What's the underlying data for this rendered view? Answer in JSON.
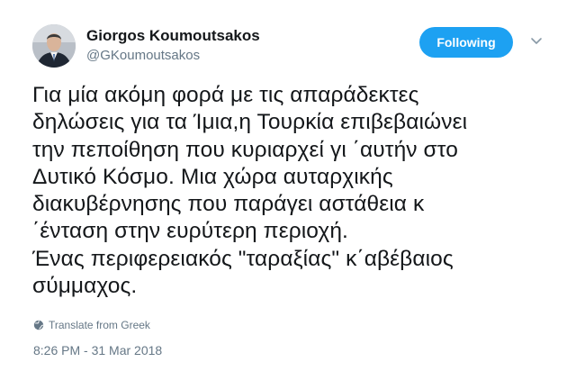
{
  "author": {
    "name": "Giorgos Koumoutsakos",
    "handle": "@GKoumoutsakos"
  },
  "follow_button": {
    "label": "Following"
  },
  "tweet": {
    "lines": [
      "Για μία ακόμη φορά με τις απαράδεκτες",
      "δηλώσεις για τα Ίμια,η Τουρκία επιβεβαιώνει",
      "την πεποίθηση που κυριαρχεί γι ΄αυτήν στο",
      "Δυτικό Κόσμο. Μια χώρα αυταρχικής",
      "διακυβέρνησης που παράγει αστάθεια κ",
      "΄ένταση στην ευρύτερη περιοχή.",
      "Ένας περιφερειακός \"ταραξίας\" κ΄αβέβαιος",
      "σύμμαχος."
    ]
  },
  "translate": {
    "label": "Translate from Greek",
    "icon": "globe-icon"
  },
  "timestamp": "8:26 PM - 31 Mar 2018",
  "colors": {
    "accent": "#1da1f2",
    "text": "#14171a",
    "secondary": "#657786"
  }
}
